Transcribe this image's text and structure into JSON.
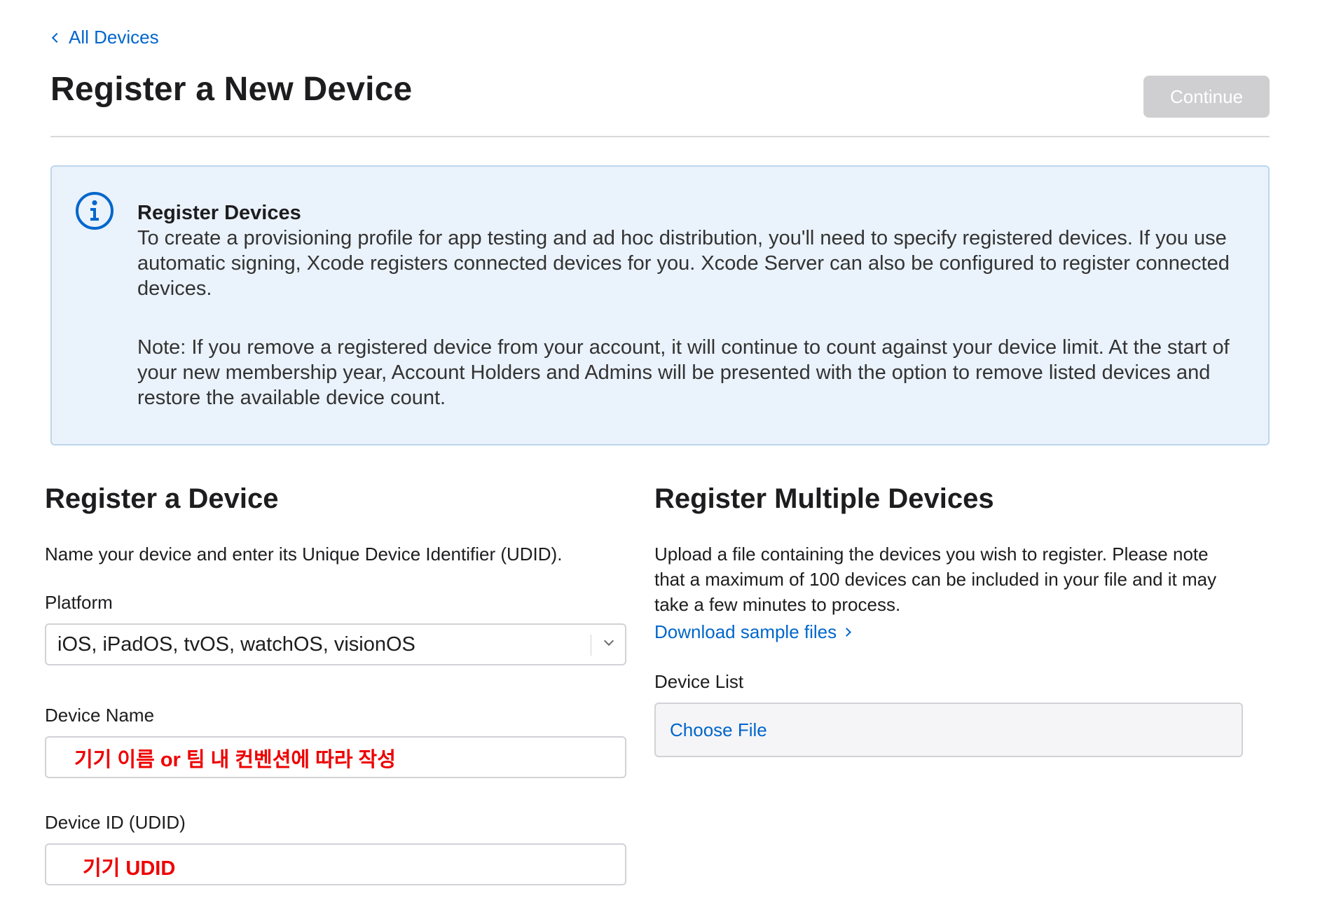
{
  "nav": {
    "back_label": "All Devices"
  },
  "header": {
    "title": "Register a New Device",
    "continue_label": "Continue"
  },
  "info": {
    "icon": "info-circle-icon",
    "heading": "Register Devices",
    "paragraph_1": "To create a provisioning profile for app testing and ad hoc distribution, you'll need to specify registered devices. If you use automatic signing, Xcode registers connected devices for you. Xcode Server can also be configured to register connected devices.",
    "paragraph_2": "Note: If you remove a registered device from your account, it will continue to count against your device limit. At the start of your new membership year, Account Holders and Admins will be presented with the option to remove listed devices and restore the available device count."
  },
  "single": {
    "title": "Register a Device",
    "description": "Name your device and enter its Unique Device Identifier (UDID).",
    "platform_label": "Platform",
    "platform_value": "iOS, iPadOS, tvOS, watchOS, visionOS",
    "device_name_label": "Device Name",
    "device_name_annotation": "기기 이름 or 팀 내 컨벤션에 따라 작성",
    "device_id_label": "Device ID (UDID)",
    "device_id_annotation": "기기 UDID"
  },
  "multiple": {
    "title": "Register Multiple Devices",
    "description": "Upload a file containing the devices you wish to register. Please note that a maximum of 100 devices can be included in your file and it may take a few minutes to process.",
    "download_link": "Download sample files",
    "device_list_label": "Device List",
    "choose_file_label": "Choose File"
  },
  "colors": {
    "accent": "#0066cc",
    "info_bg": "#eaf2fb",
    "info_border": "#bed6ee",
    "annotation": "#ee0000",
    "disabled_button": "#cfcfd1"
  }
}
